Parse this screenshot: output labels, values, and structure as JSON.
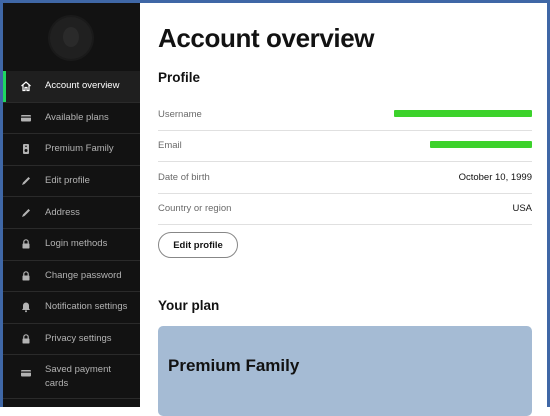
{
  "sidebar": {
    "items": [
      {
        "label": "Account overview",
        "icon": "home-icon",
        "active": true
      },
      {
        "label": "Available plans",
        "icon": "card-icon"
      },
      {
        "label": "Premium Family",
        "icon": "speaker-icon"
      },
      {
        "label": "Edit profile",
        "icon": "pen-icon"
      },
      {
        "label": "Address",
        "icon": "pen-icon"
      },
      {
        "label": "Login methods",
        "icon": "lock-icon"
      },
      {
        "label": "Change password",
        "icon": "lock-icon"
      },
      {
        "label": "Notification settings",
        "icon": "bell-icon"
      },
      {
        "label": "Privacy settings",
        "icon": "lock-icon"
      },
      {
        "label": "Saved payment cards",
        "icon": "card-icon"
      }
    ]
  },
  "main": {
    "title": "Account overview",
    "profile_heading": "Profile",
    "rows": [
      {
        "key": "Username",
        "value": ""
      },
      {
        "key": "Email",
        "value": ""
      },
      {
        "key": "Date of birth",
        "value": "October 10, 1999"
      },
      {
        "key": "Country or region",
        "value": "USA"
      }
    ],
    "edit_profile_label": "Edit profile",
    "plan_heading": "Your plan",
    "plan_name": "Premium Family"
  },
  "colors": {
    "sidebar_bg": "#121212",
    "accent": "#1ed760",
    "plan_card": "#a5bbd4",
    "redaction": "#3cd22b"
  }
}
